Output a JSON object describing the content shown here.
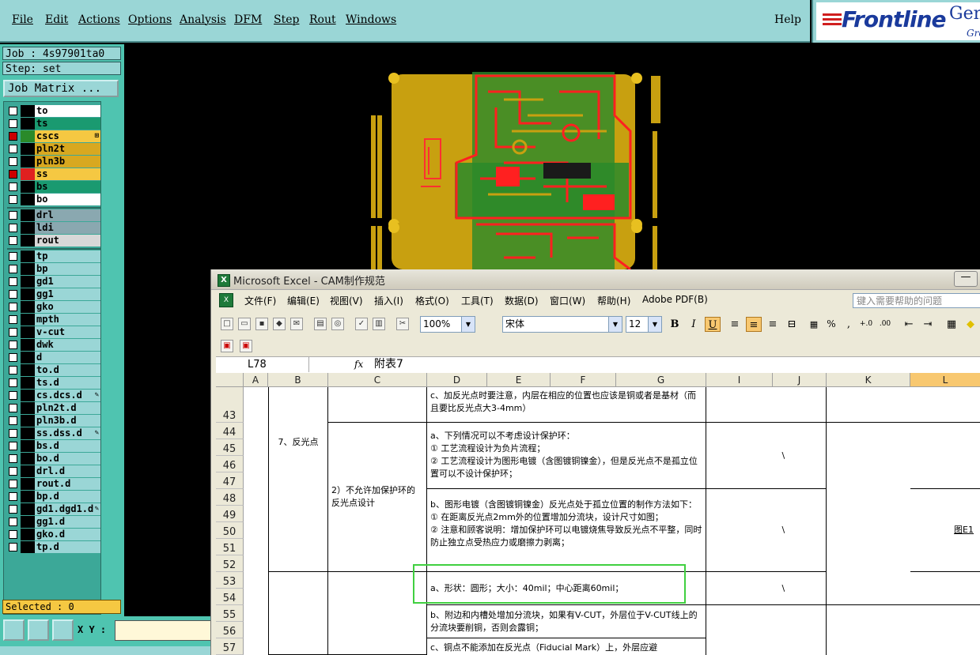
{
  "menu": {
    "items": [
      "File",
      "Edit",
      "Actions",
      "Options",
      "Analysis",
      "DFM",
      "Step",
      "Rout",
      "Windows"
    ],
    "help": "Help"
  },
  "brand": {
    "name": "Frontline",
    "product": "Gen",
    "sub": "Gro"
  },
  "job": {
    "job": "Job : 4s97901ta0",
    "step": "Step: set",
    "matrix_button": "Job Matrix ..."
  },
  "layers": [
    {
      "name": "to",
      "color": "#ffffff",
      "sw": "#000000",
      "on": false
    },
    {
      "name": "ts",
      "color": "#1a9a70",
      "sw": "#000000",
      "on": false
    },
    {
      "name": "cs",
      "color": "#f5c842",
      "sw": "#2a8a2a",
      "on": true,
      "tag": "⊞"
    },
    {
      "name": "pln2t",
      "color": "#d8a820",
      "sw": "#000000",
      "on": false
    },
    {
      "name": "pln3b",
      "color": "#d8a820",
      "sw": "#000000",
      "on": false
    },
    {
      "name": "ss",
      "color": "#f5c842",
      "sw": "#e02020",
      "on": true
    },
    {
      "name": "bs",
      "color": "#1a9a70",
      "sw": "#000000",
      "on": false
    },
    {
      "name": "bo",
      "color": "#ffffff",
      "sw": "#000000",
      "on": false
    },
    {
      "name": "drl",
      "color": "#8aa8b0",
      "sw": "#000000",
      "on": false
    },
    {
      "name": "ldi",
      "color": "#8aa8b0",
      "sw": "#000000",
      "on": false
    },
    {
      "name": "rout",
      "color": "#d8d8d8",
      "sw": "#000000",
      "on": false
    },
    {
      "name": "tp",
      "color": "#9ad6d6",
      "sw": "#000000",
      "on": false
    },
    {
      "name": "bp",
      "color": "#9ad6d6",
      "sw": "#000000",
      "on": false
    },
    {
      "name": "gd1",
      "color": "#9ad6d6",
      "sw": "#000000",
      "on": false
    },
    {
      "name": "gg1",
      "color": "#9ad6d6",
      "sw": "#000000",
      "on": false
    },
    {
      "name": "gko",
      "color": "#9ad6d6",
      "sw": "#000000",
      "on": false
    },
    {
      "name": "mpth",
      "color": "#9ad6d6",
      "sw": "#000000",
      "on": false
    },
    {
      "name": "v-cut",
      "color": "#9ad6d6",
      "sw": "#000000",
      "on": false
    },
    {
      "name": "dwk",
      "color": "#9ad6d6",
      "sw": "#000000",
      "on": false
    },
    {
      "name": "d",
      "color": "#9ad6d6",
      "sw": "#000000",
      "on": false
    },
    {
      "name": "to.d",
      "color": "#9ad6d6",
      "sw": "#000000",
      "on": false
    },
    {
      "name": "ts.d",
      "color": "#9ad6d6",
      "sw": "#000000",
      "on": false
    },
    {
      "name": "cs.d",
      "color": "#9ad6d6",
      "sw": "#000000",
      "on": false,
      "tag": "✎"
    },
    {
      "name": "pln2t.d",
      "color": "#9ad6d6",
      "sw": "#000000",
      "on": false
    },
    {
      "name": "pln3b.d",
      "color": "#9ad6d6",
      "sw": "#000000",
      "on": false
    },
    {
      "name": "ss.d",
      "color": "#9ad6d6",
      "sw": "#000000",
      "on": false,
      "tag": "✎"
    },
    {
      "name": "bs.d",
      "color": "#9ad6d6",
      "sw": "#000000",
      "on": false
    },
    {
      "name": "bo.d",
      "color": "#9ad6d6",
      "sw": "#000000",
      "on": false
    },
    {
      "name": "drl.d",
      "color": "#9ad6d6",
      "sw": "#000000",
      "on": false
    },
    {
      "name": "rout.d",
      "color": "#9ad6d6",
      "sw": "#000000",
      "on": false
    },
    {
      "name": "bp.d",
      "color": "#9ad6d6",
      "sw": "#000000",
      "on": false
    },
    {
      "name": "gd1.d",
      "color": "#9ad6d6",
      "sw": "#000000",
      "on": false,
      "tag": "✎"
    },
    {
      "name": "gg1.d",
      "color": "#9ad6d6",
      "sw": "#000000",
      "on": false
    },
    {
      "name": "gko.d",
      "color": "#9ad6d6",
      "sw": "#000000",
      "on": false
    },
    {
      "name": "tp.d",
      "color": "#9ad6d6",
      "sw": "#000000",
      "on": false
    }
  ],
  "selected": "Selected : 0",
  "coords": {
    "label": "X Y :",
    "value": ""
  },
  "excel": {
    "title": "Microsoft Excel - CAM制作规范",
    "menu": [
      "文件(F)",
      "编辑(E)",
      "视图(V)",
      "插入(I)",
      "格式(O)",
      "工具(T)",
      "数据(D)",
      "窗口(W)",
      "帮助(H)",
      "Adobe PDF(B)"
    ],
    "help_placeholder": "键入需要帮助的问题",
    "zoom": "100%",
    "font": "宋体",
    "font_size": "12",
    "name_box": "L78",
    "fx": "fx",
    "formula": "附表7",
    "columns": [
      "A",
      "B",
      "C",
      "D",
      "E",
      "F",
      "G",
      "I",
      "J",
      "K",
      "L"
    ],
    "rows": [
      "43",
      "44",
      "45",
      "46",
      "47",
      "48",
      "49",
      "50",
      "51",
      "52",
      "53",
      "54",
      "55",
      "56",
      "57"
    ],
    "cells": {
      "d43": "c、加反光点时要注意，内层在相应的位置也应该是铜或者是基材（而且要比反光点大3-4mm）",
      "b45": "7、反光点",
      "c48": "2）不允许加保护环的反光点设计",
      "d44": "a、下列情况可以不考虑设计保护环：\n① 工艺流程设计为负片流程；\n② 工艺流程设计为图形电镀（含图镀铜镍金），但是反光点不是孤立位置可以不设计保护环；",
      "d48": "b、图形电镀（含图镀铜镍金）反光点处于孤立位置的制作方法如下：\n① 在距离反光点2mm外的位置增加分流块，设计尺寸如图；\n② 注意和顾客说明：增加保护环可以电镀烧焦导致反光点不平整，同时防止独立点受热应力或磨擦力剥离；",
      "d53": "a、形状：圆形；大小：40mil；中心距离60mil；",
      "d55": "b、附边和内槽处增加分流块，如果有V-CUT，外层位于V-CUT线上的分流块要削铜，否则会露铜；",
      "d57": "c、铜点不能添加在反光点（Fiducial Mark）上，外层应避",
      "slash": "\\",
      "fig": "图E1"
    }
  }
}
